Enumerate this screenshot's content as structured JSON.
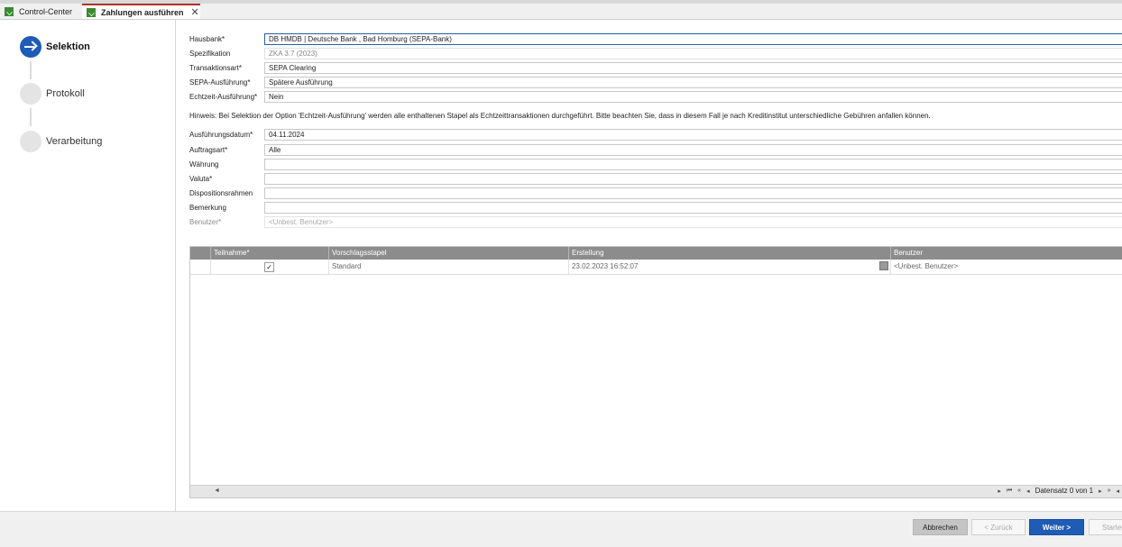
{
  "tabs": [
    {
      "label": "Control-Center",
      "active": false
    },
    {
      "label": "Zahlungen ausführen",
      "active": true
    }
  ],
  "steps": [
    {
      "label": "Selektion",
      "active": true
    },
    {
      "label": "Protokoll",
      "active": false
    },
    {
      "label": "Verarbeitung",
      "active": false
    }
  ],
  "form": {
    "hausbank": {
      "label": "Hausbank*",
      "value": "DB HMDB  |  Deutsche Bank , Bad Homburg (SEPA-Bank)"
    },
    "spezifikation": {
      "label": "Spezifikation",
      "value": "ZKA 3.7 (2023)"
    },
    "transaktionsart": {
      "label": "Transaktionsart*",
      "value": "SEPA Clearing"
    },
    "sepa_ausfuehrung": {
      "label": "SEPA-Ausführung*",
      "value": "Spätere Ausführung"
    },
    "echtzeit": {
      "label": "Echtzeit-Ausführung*",
      "value": "Nein"
    },
    "hint": "Hinweis: Bei Selektion der Option 'Echtzeit-Ausführung' werden alle enthaltenen Stapel als Echtzeittransaktionen durchgeführt. Bitte beachten Sie, dass in diesem Fall je nach Kreditinstitut unterschiedliche Gebühren anfallen können.",
    "ausfuehrungsdatum": {
      "label": "Ausführungsdatum*",
      "value": "04.11.2024"
    },
    "auftragsart": {
      "label": "Auftragsart*",
      "value": "Alle"
    },
    "waehrung": {
      "label": "Währung",
      "value": ""
    },
    "valuta": {
      "label": "Valuta*",
      "value": ""
    },
    "dispositionsrahmen": {
      "label": "Dispositionsrahmen",
      "value": ""
    },
    "bemerkung": {
      "label": "Bemerkung",
      "value": ""
    },
    "benutzer": {
      "label": "Benutzer*",
      "placeholder": "<Unbest. Benutzer>"
    }
  },
  "grid": {
    "columns": [
      "Teilnahme*",
      "Vorschlagsstapel",
      "Erstellung",
      "Benutzer"
    ],
    "rows": [
      {
        "teilnahme": "✓",
        "vorschlagsstapel": "Standard",
        "erstellung": "23.02.2023 16:52:07",
        "benutzer": "<Unbest. Benutzer>"
      }
    ],
    "pager": "Datensatz 0 von 1"
  },
  "buttons": {
    "cancel": "Abbrechen",
    "back": "< Zurück",
    "next": "Weiter >",
    "start": "Starten"
  }
}
